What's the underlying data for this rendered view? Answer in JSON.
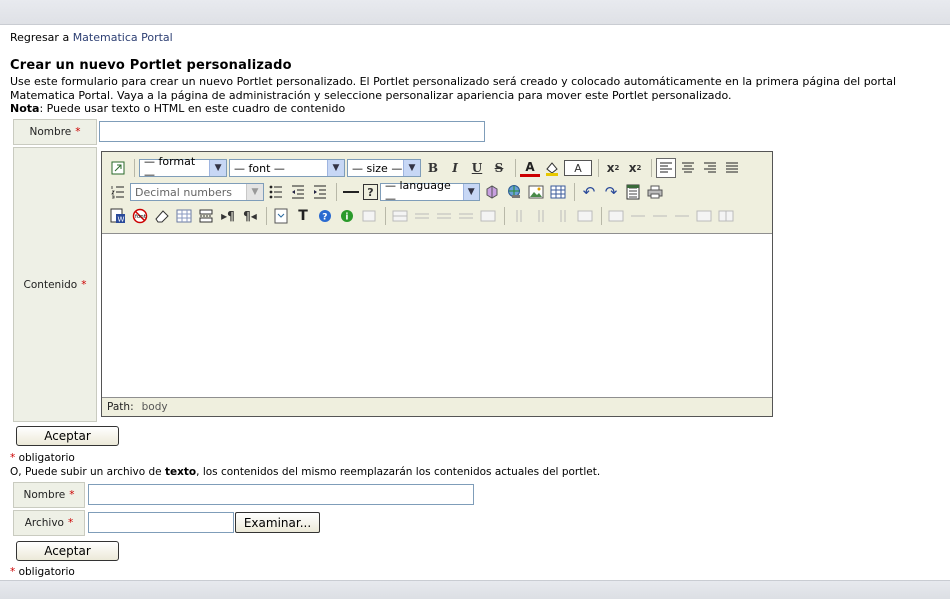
{
  "header": {
    "back_prefix": "Regresar a",
    "back_link": "Matematica Portal"
  },
  "form": {
    "title": "Crear un nuevo Portlet personalizado",
    "description": "Use este formulario para crear un nuevo Portlet personalizado. El Portlet personalizado será creado y colocado automáticamente en la primera página del portal Matematica Portal. Vaya a la página de administración y seleccione personalizar apariencia para mover este Portlet personalizado.",
    "note_label": "Nota",
    "note_text": ": Puede usar texto o HTML en este cuadro de contenido",
    "name_label": "Nombre",
    "content_label": "Contenido",
    "required_mark": "*",
    "submit_label": "Aceptar",
    "required_legend": "obligatorio"
  },
  "editor": {
    "format_select": "— format —",
    "font_select": "— font —",
    "size_select": "— size —",
    "list_style_select": "Decimal numbers",
    "language_select": "— language —",
    "text_color_box": "A",
    "path_label": "Path:",
    "path_value": "body"
  },
  "upload": {
    "desc_prefix": "O, Puede subir un archivo de ",
    "desc_bold": "texto",
    "desc_suffix": ", los contenidos del mismo reemplazarán los contenidos actuales del portlet.",
    "name_label": "Nombre",
    "file_label": "Archivo",
    "browse_label": "Examinar...",
    "submit_label": "Aceptar",
    "required_legend": "obligatorio"
  }
}
